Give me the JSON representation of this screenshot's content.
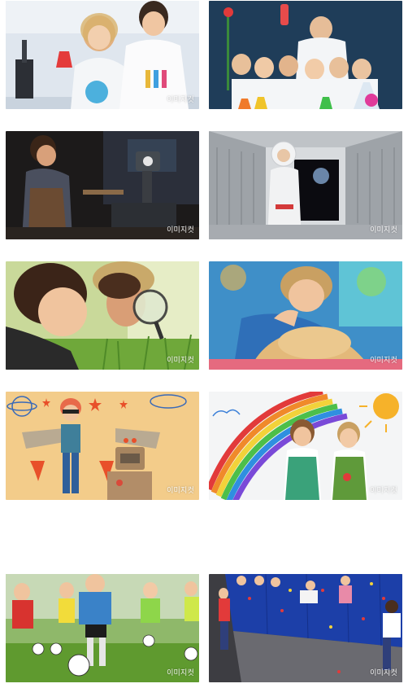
{
  "gallery": {
    "watermark": "이미지컷",
    "items": [
      {
        "subject": "children-chemistry-experiment"
      },
      {
        "subject": "scientist-with-kids-lab"
      },
      {
        "subject": "boy-with-robot-workshop"
      },
      {
        "subject": "child-astronaut-spaceship"
      },
      {
        "subject": "kids-magnifying-glass-grass"
      },
      {
        "subject": "child-playing-kinetic-sand"
      },
      {
        "subject": "boy-with-drawn-wings-robot"
      },
      {
        "subject": "girls-painting-rainbow-wall"
      },
      {
        "subject": "kids-playing-soccer"
      },
      {
        "subject": "kids-climbing-wall"
      }
    ]
  }
}
